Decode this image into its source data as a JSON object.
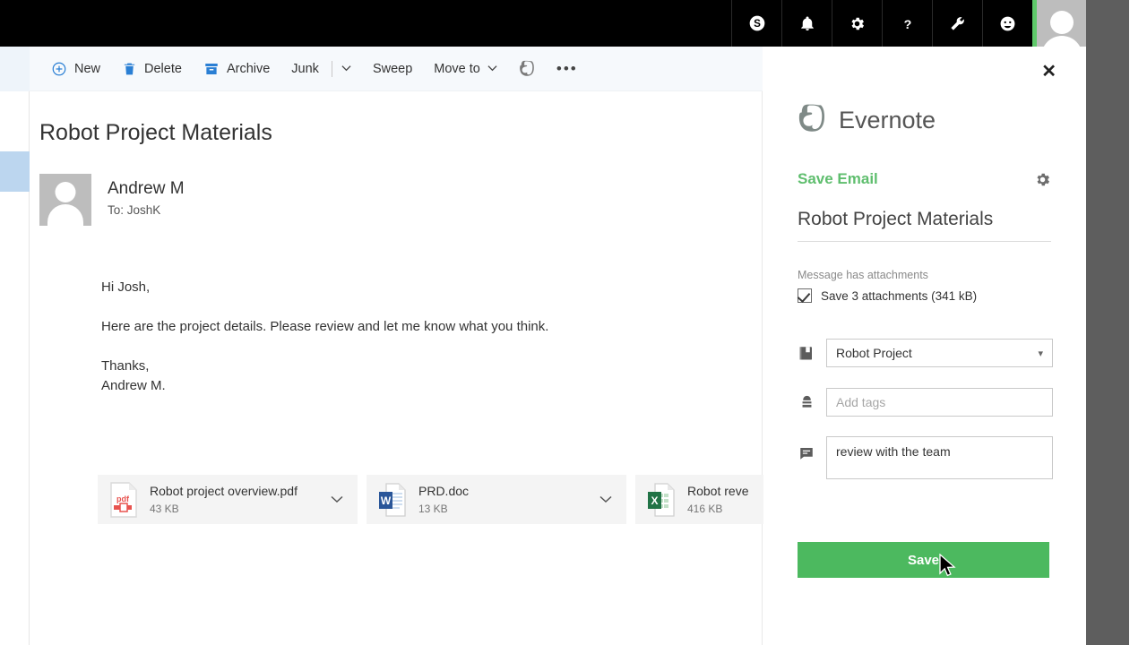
{
  "topbar": {
    "icons": [
      {
        "name": "skype-icon",
        "label": "Skype"
      },
      {
        "name": "bell-icon",
        "label": "Notifications"
      },
      {
        "name": "gear-icon",
        "label": "Settings"
      },
      {
        "name": "question-icon",
        "label": "Help"
      },
      {
        "name": "wrench-icon",
        "label": "Tools"
      },
      {
        "name": "smiley-icon",
        "label": "Feedback"
      }
    ],
    "avatar_label": "Account",
    "accent_color": "#5fc96a",
    "background_color": "#000000"
  },
  "toolbar": {
    "new_label": "New",
    "delete_label": "Delete",
    "archive_label": "Archive",
    "junk_label": "Junk",
    "sweep_label": "Sweep",
    "move_to_label": "Move to",
    "evernote_label": "Evernote",
    "more_label": "•••",
    "chevron": "⌄",
    "icon_color": "#2a7fd4"
  },
  "mail": {
    "subject": "Robot Project Materials",
    "sender": "Andrew M",
    "recipients": "To: JoshK",
    "body": [
      "Hi Josh,",
      "Here are the project details. Please review and let me know what you think.",
      "Thanks,"
    ],
    "signature": "Andrew M.",
    "attachments": [
      {
        "name": "Robot project overview.pdf",
        "size": "43 KB",
        "type": "pdf"
      },
      {
        "name": "PRD.doc",
        "size": "13 KB",
        "type": "doc"
      },
      {
        "name": "Robot reve",
        "size": "416 KB",
        "type": "xls"
      }
    ]
  },
  "panel": {
    "close_label": "✕",
    "brand": "Evernote",
    "action_label": "Save Email",
    "settings_label": "Settings",
    "note_title": "Robot Project Materials",
    "attachments_note": "Message has attachments",
    "attachments_checkbox_label": "Save 3 attachments (341 kB)",
    "attachments_checked": true,
    "notebook_value": "Robot Project",
    "notebook_chevron": "▾",
    "tags_placeholder": "Add tags",
    "tags_value": "",
    "comment_value": "review with the team",
    "save_button_label": "Save",
    "accent_green": "#4cb95f",
    "link_green": "#5fbe6e"
  }
}
